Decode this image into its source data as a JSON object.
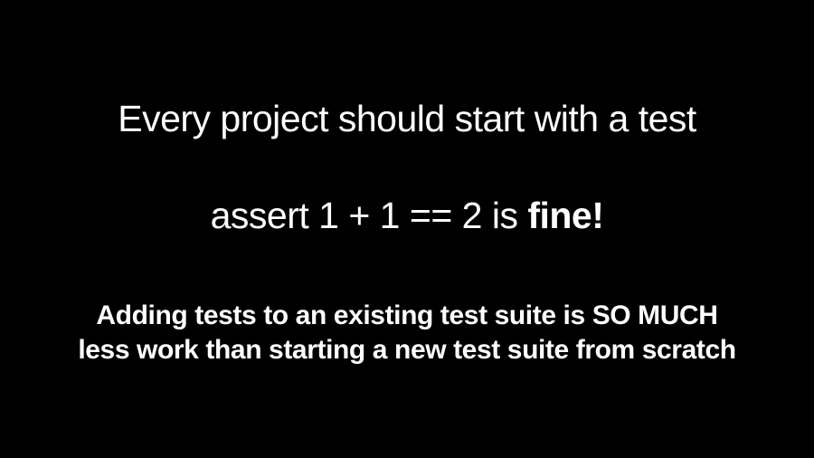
{
  "slide": {
    "line1": "Every project should start with a test",
    "line2_prefix": "assert 1 + 1 == 2 is ",
    "line2_bold": "fine!",
    "line3": "Adding tests to an existing test suite is SO MUCH",
    "line4": "less work than starting a new test suite from scratch"
  }
}
